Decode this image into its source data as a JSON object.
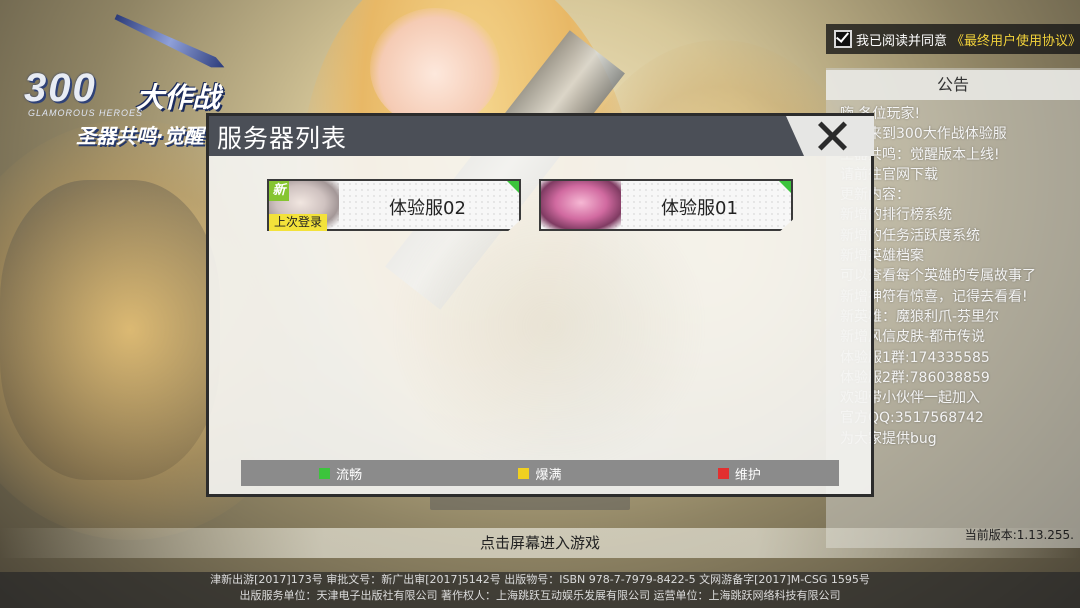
{
  "logo": {
    "number": "300",
    "title_cn": "大作战",
    "subtitle_en": "GLAMOROUS HEROES",
    "slogan": "圣器共鸣·觉醒"
  },
  "agreement": {
    "checked": true,
    "prefix": "我已阅读并同意",
    "link": "《最终用户使用协议》"
  },
  "notice": {
    "title": "公告",
    "lines": [
      "嗨 各位玩家!",
      "欢迎来到300大作战体验服",
      "圣器共鸣：觉醒版本上线!",
      "请前往官网下载",
      "更新内容：",
      "新增的排行榜系统",
      "新增的任务活跃度系统",
      "新增英雄档案",
      "可以查看每个英雄的专属故事了",
      "新增神符有惊喜，记得去看看!",
      "新英雄：魔狼利爪-芬里尔",
      "新增风信皮肤-都市传说",
      "体验服1群:174335585",
      "体验服2群:786038859",
      "欢迎带小伙伴一起加入",
      "官方QQ:3517568742",
      "为大家提供bug"
    ],
    "version": "当前版本:1.13.255."
  },
  "enter_prompt": "点击屏幕进入游戏",
  "behind_server": "体验服02",
  "footer": {
    "line1": "津新出游[2017]173号 审批文号：新广出审[2017]5142号 出版物号：ISBN 978-7-7979-8422-5 文网游备字[2017]M-CSG 1595号",
    "line2": "出版服务单位：天津电子出版社有限公司 著作权人：上海跳跃互动娱乐发展有限公司 运营单位：上海跳跃网络科技有限公司"
  },
  "server_dialog": {
    "title": "服务器列表",
    "servers": [
      {
        "name": "体验服02",
        "badge_new": "新",
        "badge_last": "上次登录",
        "status_color": "#3cc43c"
      },
      {
        "name": "体验服01",
        "status_color": "#3cc43c"
      }
    ],
    "legend": [
      {
        "label": "流畅",
        "color": "#3cc43c"
      },
      {
        "label": "爆满",
        "color": "#f0d020"
      },
      {
        "label": "维护",
        "color": "#e23030"
      }
    ]
  }
}
